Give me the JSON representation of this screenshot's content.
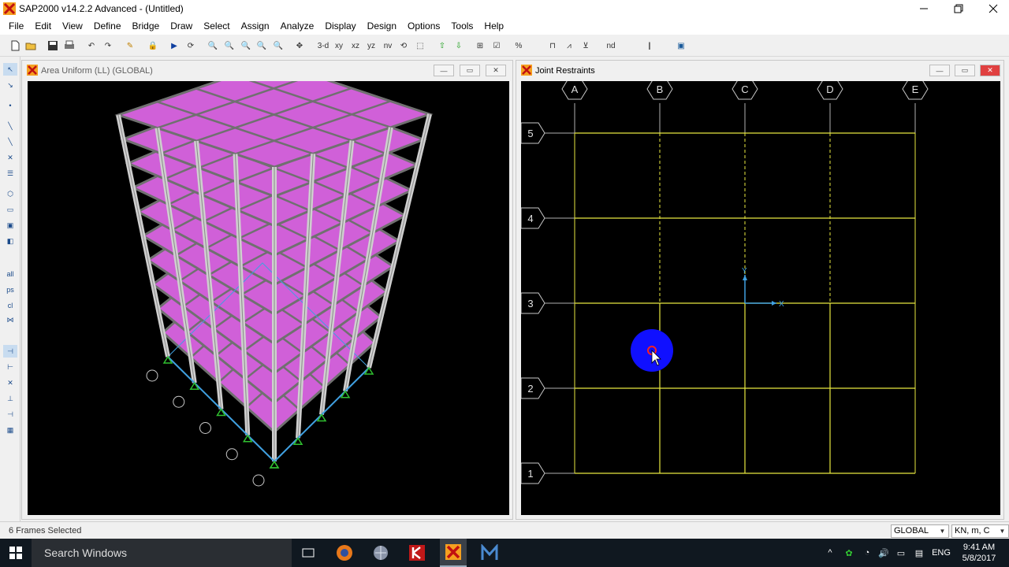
{
  "app": {
    "title": "SAP2000 v14.2.2 Advanced  - (Untitled)"
  },
  "window_controls": [
    "minimize-icon",
    "restore-icon",
    "close-icon"
  ],
  "menu": [
    "File",
    "Edit",
    "View",
    "Define",
    "Bridge",
    "Draw",
    "Select",
    "Assign",
    "Analyze",
    "Display",
    "Design",
    "Options",
    "Tools",
    "Help"
  ],
  "toolbar": {
    "view_3d": "3-d",
    "view_xy": "xy",
    "view_xz": "xz",
    "view_yz": "yz",
    "view_nv": "nv",
    "nd_label": "nd"
  },
  "left_tools": {
    "all_label": "all",
    "ps_label": "ps",
    "cl_label": "cl"
  },
  "left_pane": {
    "title": "Area Uniform (LL) (GLOBAL)"
  },
  "right_pane": {
    "title": "Joint Restraints",
    "grid_columns": [
      "A",
      "B",
      "C",
      "D",
      "E"
    ],
    "grid_rows": [
      "5",
      "4",
      "3",
      "2",
      "1"
    ],
    "axis_x": "X",
    "axis_y": "Y"
  },
  "status": {
    "message": "6 Frames Selected",
    "coord_system": "GLOBAL",
    "units": "KN, m, C"
  },
  "taskbar": {
    "search_placeholder": "Search Windows",
    "language": "ENG",
    "time": "9:41 AM",
    "date": "5/8/2017"
  },
  "colors": {
    "slab": "#d060d8",
    "grid_line": "#e8e840",
    "highlight": "#1010ff",
    "axis": "#40a0e0"
  }
}
